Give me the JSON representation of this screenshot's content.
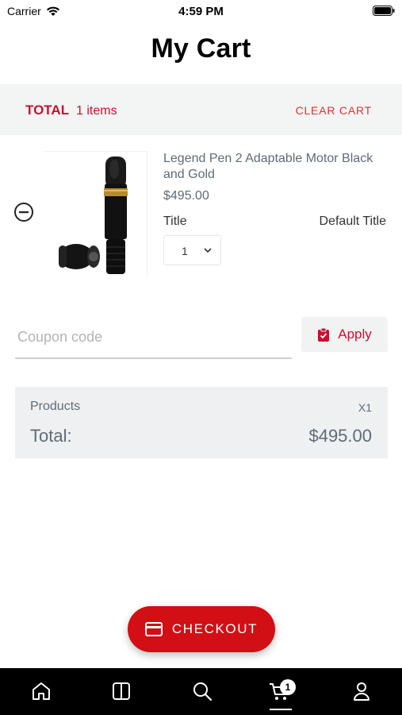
{
  "status_bar": {
    "carrier": "Carrier",
    "time": "4:59 PM"
  },
  "header": {
    "title": "My Cart"
  },
  "total_bar": {
    "total_label": "TOTAL",
    "items_count": "1 items",
    "clear_cart_label": "CLEAR CART"
  },
  "cart": {
    "items": [
      {
        "name": "Legend Pen 2 Adaptable Motor Black and Gold",
        "price": "$495.00",
        "variant_label": "Title",
        "variant_value": "Default Title",
        "quantity": "1"
      }
    ]
  },
  "coupon": {
    "placeholder": "Coupon code",
    "apply_label": "Apply"
  },
  "summary": {
    "products_label": "Products",
    "products_count": "X1",
    "total_label": "Total:",
    "total_amount": "$495.00"
  },
  "checkout": {
    "label": "CHECKOUT"
  },
  "bottom_nav": {
    "items": [
      "home-icon",
      "categories-icon",
      "search-icon",
      "cart-icon",
      "account-icon"
    ],
    "cart_badge": "1",
    "active": "cart-icon"
  },
  "colors": {
    "accent": "#c8102e",
    "checkout": "#d10f14",
    "nav_background": "#000000",
    "summary_background": "#eef0f1"
  }
}
